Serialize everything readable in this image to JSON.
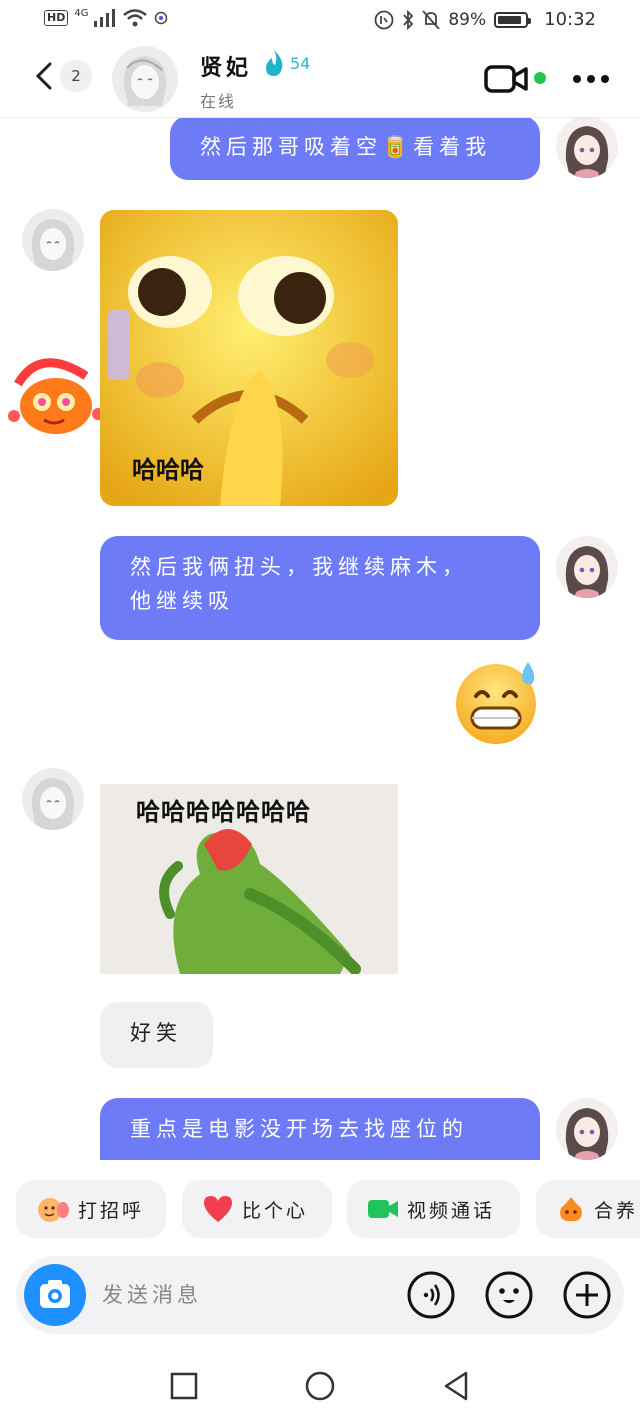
{
  "status_bar": {
    "hd": "HD",
    "network": "4G",
    "battery_percent": "89%",
    "battery_level": 0.89,
    "time": "10:32"
  },
  "header": {
    "unread_count": "2",
    "contact_name": "贤妃",
    "streak_count": "54",
    "status": "在线",
    "online_color": "#23c552"
  },
  "messages": {
    "m1": "然后那哥吸着空🥫看着我",
    "sticker1_caption": "哈哈哈",
    "m3_line1": "然后我俩扭头，我继续麻木，",
    "m3_line2": "他继续吸",
    "emoji_reply": "😅",
    "sticker2_caption": "哈哈哈哈哈哈哈",
    "m5": "好笑",
    "m6": "重点是电影没开场去找座位的"
  },
  "quick_actions": [
    {
      "label": "打招呼",
      "icon": "wave-icon"
    },
    {
      "label": "比个心",
      "icon": "heart-icon"
    },
    {
      "label": "视频通话",
      "icon": "video-call-icon"
    },
    {
      "label": "合养",
      "icon": "pet-icon"
    }
  ],
  "input": {
    "placeholder": "发送消息"
  },
  "colors": {
    "outgoing_bubble": "#6d7bf7",
    "incoming_bubble": "#f0f0f2",
    "accent_blue": "#1e90ff"
  }
}
